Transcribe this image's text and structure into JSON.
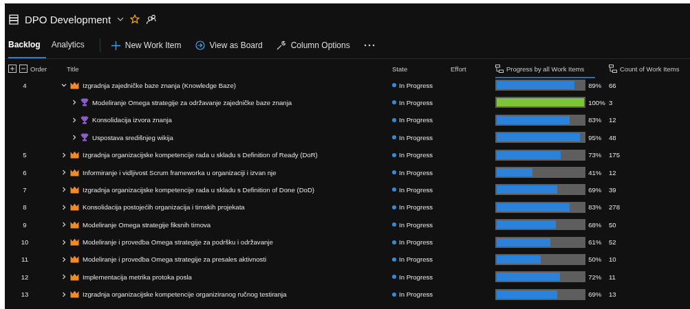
{
  "header": {
    "title": "DPO Development",
    "favorite": true
  },
  "tabs": [
    {
      "label": "Backlog",
      "selected": true
    },
    {
      "label": "Analytics",
      "selected": false
    }
  ],
  "toolbar": [
    {
      "kind": "new",
      "label": "New Work Item"
    },
    {
      "kind": "board",
      "label": "View as Board"
    },
    {
      "kind": "columns",
      "label": "Column Options"
    },
    {
      "kind": "more"
    }
  ],
  "table": {
    "columns": [
      "Order",
      "Title",
      "State",
      "Effort",
      "Progress by all Work Items",
      "Count of Work Items"
    ],
    "rows": [
      {
        "order": "4",
        "kind": "epic",
        "expanded": true,
        "title": "Izgradnja zajedničke baze znanja (Knowledge Baze)",
        "state": "In Progress",
        "level": 0.89,
        "percent": "89%",
        "count": "66",
        "children": [
          {
            "kind": "feature",
            "expanded": false,
            "title": "Modeliranje Omega strategije za održavanje zajedničke baze znanja",
            "state": "In Progress",
            "level": 1,
            "percent": "100%",
            "count": "3"
          },
          {
            "kind": "feature",
            "expanded": false,
            "title": "Konsolidacija izvora znanja",
            "state": "In Progress",
            "level": 0.83,
            "percent": "83%",
            "count": "12"
          },
          {
            "kind": "feature",
            "expanded": false,
            "title": "Uspostava središnjeg wikija",
            "state": "In Progress",
            "level": 0.95,
            "percent": "95%",
            "count": "48"
          }
        ]
      },
      {
        "order": "5",
        "kind": "epic",
        "expanded": false,
        "title": "Izgradnja organizacijske kompetencije rada u skladu s Definition of Ready (DoR)",
        "state": "In Progress",
        "level": 0.73,
        "percent": "73%",
        "count": "175"
      },
      {
        "order": "6",
        "kind": "epic",
        "expanded": false,
        "title": "Informiranje i vidljivost Scrum frameworka u organizaciji i izvan nje",
        "state": "In Progress",
        "level": 0.41,
        "percent": "41%",
        "count": "12"
      },
      {
        "order": "7",
        "kind": "epic",
        "expanded": false,
        "title": "Izgradnja organizacijske kompetencije rada u skladu s Definition of Done (DoD)",
        "state": "In Progress",
        "level": 0.69,
        "percent": "69%",
        "count": "39"
      },
      {
        "order": "8",
        "kind": "epic",
        "expanded": false,
        "title": "Konsolidacija postojećih organizacija i timskih projekata",
        "state": "In Progress",
        "level": 0.83,
        "percent": "83%",
        "count": "278"
      },
      {
        "order": "9",
        "kind": "epic",
        "expanded": false,
        "title": "Modeliranje Omega strategije fiksnih timova",
        "state": "In Progress",
        "level": 0.68,
        "percent": "68%",
        "count": "50"
      },
      {
        "order": "10",
        "kind": "epic",
        "expanded": false,
        "title": "Modeliranje i provedba Omega strategije za podršku i održavanje",
        "state": "In Progress",
        "level": 0.61,
        "percent": "61%",
        "count": "52"
      },
      {
        "order": "11",
        "kind": "epic",
        "expanded": false,
        "title": "Modeliranje i provedba Omega strategije za presales aktivnosti",
        "state": "In Progress",
        "level": 0.5,
        "percent": "50%",
        "count": "10"
      },
      {
        "order": "12",
        "kind": "epic",
        "expanded": false,
        "title": "Implementacija metrika protoka posla",
        "state": "In Progress",
        "level": 0.72,
        "percent": "72%",
        "count": "11"
      },
      {
        "order": "13",
        "kind": "epic",
        "expanded": false,
        "title": "Izgradnja organizacijske kompetencije organiziranog ručnog testiranja",
        "state": "In Progress",
        "level": 0.69,
        "percent": "69%",
        "count": "13"
      }
    ]
  }
}
